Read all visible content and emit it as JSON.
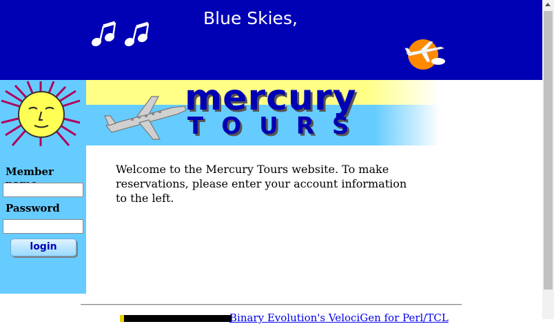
{
  "header": {
    "banner_text": "Blue Skies,",
    "notes_icon": "music-notes-icon",
    "plane_icon": "airplane-sun-icon"
  },
  "logo": {
    "title": "mercury",
    "subtitle": "TOURS"
  },
  "login": {
    "member_label": "Member name",
    "password_label": "Password",
    "username_value": "",
    "password_value": "",
    "button_label": "login"
  },
  "main": {
    "welcome_text": "Welcome to the Mercury Tours website. To make reservations, please enter your account information to the left."
  },
  "footer": {
    "link_text": "Binary Evolution's VelociGen for Perl/TCL"
  },
  "colors": {
    "banner_blue": "#0000b4",
    "sidebar_blue": "#66ccff",
    "logo_yellow": "#ffff88"
  }
}
